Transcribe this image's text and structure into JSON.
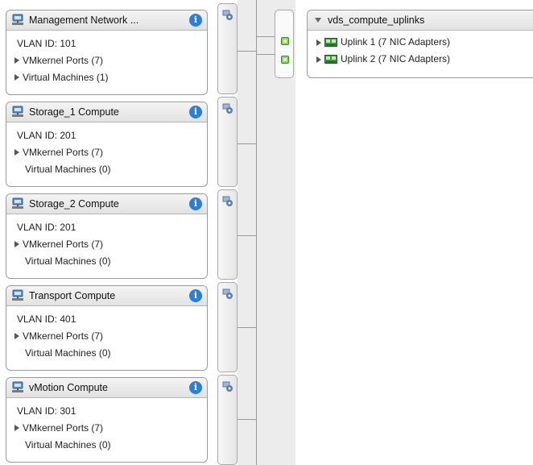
{
  "port_groups": [
    {
      "title": "Management Network ...",
      "vlan": "VLAN ID: 101",
      "vmkernel": "VMkernel Ports (7)",
      "vms": "Virtual Machines (1)",
      "vms_expandable": true
    },
    {
      "title": "Storage_1 Compute",
      "vlan": "VLAN ID: 201",
      "vmkernel": "VMkernel Ports (7)",
      "vms": "Virtual Machines (0)",
      "vms_expandable": false
    },
    {
      "title": "Storage_2 Compute",
      "vlan": "VLAN ID: 201",
      "vmkernel": "VMkernel Ports (7)",
      "vms": "Virtual Machines (0)",
      "vms_expandable": false
    },
    {
      "title": "Transport Compute",
      "vlan": "VLAN ID: 401",
      "vmkernel": "VMkernel Ports (7)",
      "vms": "Virtual Machines (0)",
      "vms_expandable": false
    },
    {
      "title": "vMotion Compute",
      "vlan": "VLAN ID: 301",
      "vmkernel": "VMkernel Ports (7)",
      "vms": "Virtual Machines (0)",
      "vms_expandable": false
    }
  ],
  "info_glyph": "i",
  "uplinks": {
    "title": "vds_compute_uplinks",
    "items": [
      {
        "label": "Uplink 1 (7 NIC Adapters)"
      },
      {
        "label": "Uplink 2 (7 NIC Adapters)"
      }
    ]
  },
  "icons": {
    "port_group": "network-portgroup-icon",
    "column": "port-settings-icon",
    "physical_port": "green-port-icon",
    "nic": "nic-adapter-icon",
    "info": "info-icon"
  },
  "colors": {
    "info_blue": "#2c7fd6",
    "nic_green": "#3a9a3a",
    "port_green": "#8fd36a"
  }
}
